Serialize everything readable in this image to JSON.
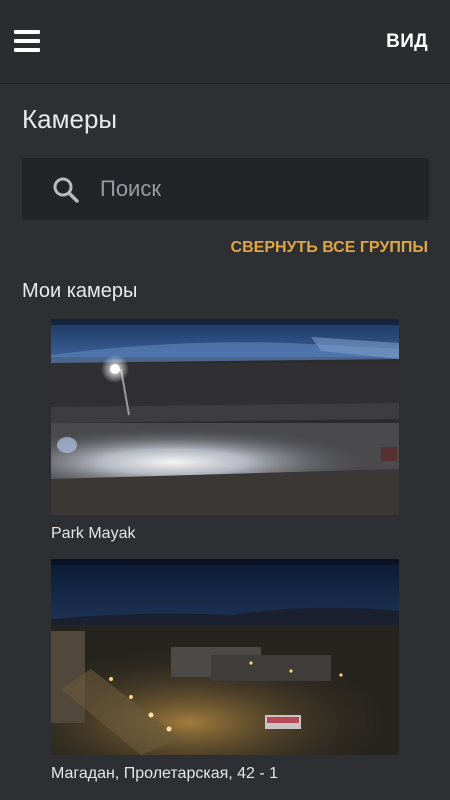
{
  "header": {
    "view_label": "ВИД"
  },
  "page": {
    "title": "Камеры"
  },
  "search": {
    "placeholder": "Поиск",
    "value": ""
  },
  "actions": {
    "collapse_all_label": "СВЕРНУТЬ ВСЕ ГРУППЫ"
  },
  "group": {
    "title": "Мои камеры",
    "cameras": [
      {
        "name": "Park Mayak"
      },
      {
        "name": "Магадан, Пролетарская, 42 - 1"
      }
    ]
  },
  "colors": {
    "background": "#2e2f33",
    "accent": "#e0a642",
    "search_bg": "#232427"
  },
  "icons": [
    "menu-icon",
    "search-icon"
  ]
}
